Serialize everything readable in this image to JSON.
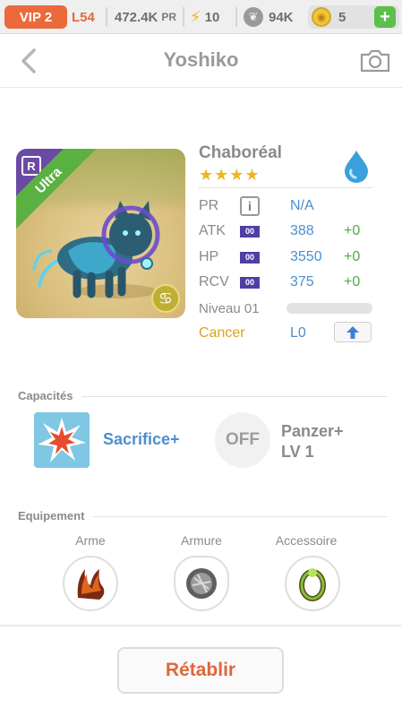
{
  "topbar": {
    "vip": "VIP 2",
    "level": "L54",
    "pr_value": "472.4K",
    "pr_unit": "PR",
    "energy": "10",
    "paw_value": "94K",
    "coins": "5",
    "plus": "+"
  },
  "header": {
    "title": "Yoshiko"
  },
  "creature": {
    "name": "Chaboréal",
    "stars": "★★★★",
    "rarity": "R",
    "grade": "Ultra",
    "zodiac_symbol": "♋",
    "element_color": "#3aa0dc",
    "stats": [
      {
        "label": "PR",
        "value": "N/A",
        "bonus": ""
      },
      {
        "label": "ATK",
        "tag": "00",
        "value": "388",
        "bonus": "+0"
      },
      {
        "label": "HP",
        "tag": "00",
        "value": "3550",
        "bonus": "+0"
      },
      {
        "label": "RCV",
        "tag": "00",
        "value": "375",
        "bonus": "+0"
      }
    ],
    "info_button": "i",
    "level_label": "Niveau 01",
    "level_progress": 0,
    "zodiac": "Cancer",
    "zodiac_level": "L0"
  },
  "abilities": {
    "title": "Capacités",
    "skill1": "Sacrifice+",
    "skill2_badge": "OFF",
    "skill2_name": "Panzer+",
    "skill2_level": "LV 1"
  },
  "equipment": {
    "title": "Equipement",
    "weapon": "Arme",
    "armor": "Armure",
    "accessory": "Accessoire"
  },
  "footer": {
    "reset_label": "Rétablir"
  },
  "colors": {
    "accent": "#e0673a",
    "value_blue": "#4a8fcf",
    "bonus_green": "#55a84b",
    "gold": "#d9a21b"
  }
}
